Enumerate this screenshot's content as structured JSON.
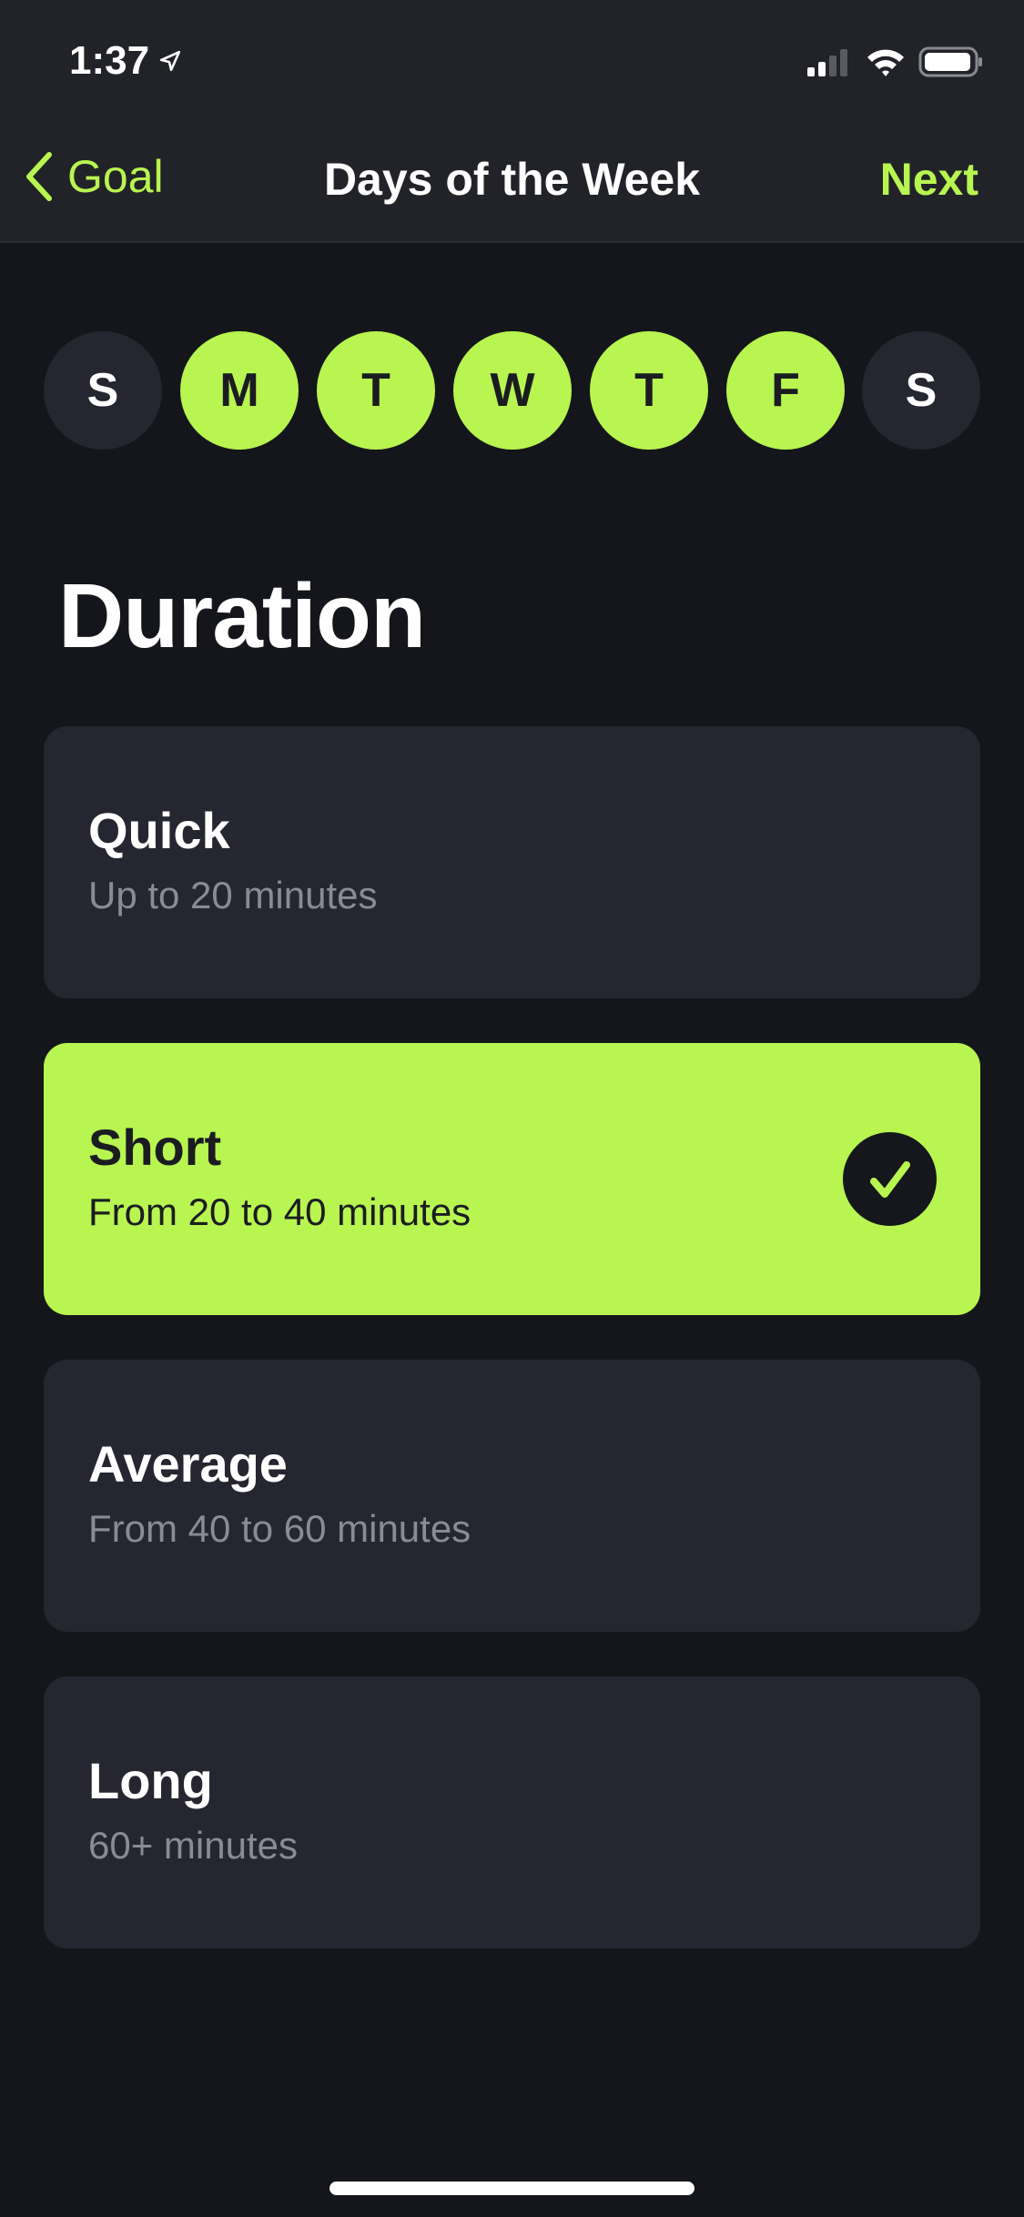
{
  "status_bar": {
    "time": "1:37",
    "location_icon": "location-arrow-icon",
    "signal_icon": "cellular-signal-icon",
    "wifi_icon": "wifi-icon",
    "battery_icon": "battery-icon"
  },
  "nav": {
    "back_label": "Goal",
    "title": "Days of the Week",
    "next_label": "Next"
  },
  "days": [
    {
      "label": "S",
      "selected": false
    },
    {
      "label": "M",
      "selected": true
    },
    {
      "label": "T",
      "selected": true
    },
    {
      "label": "W",
      "selected": true
    },
    {
      "label": "T",
      "selected": true
    },
    {
      "label": "F",
      "selected": true
    },
    {
      "label": "S",
      "selected": false
    }
  ],
  "section_title": "Duration",
  "options": [
    {
      "title": "Quick",
      "subtitle": "Up to 20 minutes",
      "selected": false
    },
    {
      "title": "Short",
      "subtitle": "From 20 to 40 minutes",
      "selected": true
    },
    {
      "title": "Average",
      "subtitle": "From 40 to 60 minutes",
      "selected": false
    },
    {
      "title": "Long",
      "subtitle": "60+ minutes",
      "selected": false
    }
  ],
  "colors": {
    "accent": "#b8f550",
    "background": "#15161b",
    "card": "#25262f",
    "nav_bar": "#222328"
  }
}
